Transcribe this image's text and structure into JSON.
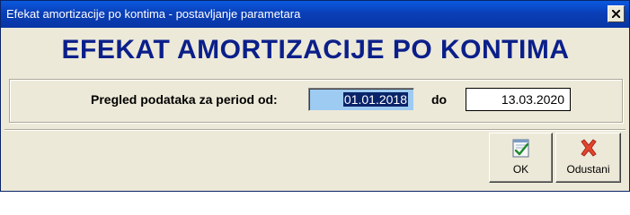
{
  "window": {
    "title": "Efekat amortizacije po kontima - postavljanje parametara"
  },
  "banner": {
    "text": "EFEKAT AMORTIZACIJE PO KONTIMA"
  },
  "period": {
    "label_from": "Pregled podataka za period od:",
    "date_from": "01.01.2018",
    "label_to": "do",
    "date_to": "13.03.2020"
  },
  "buttons": {
    "ok": "OK",
    "cancel": "Odustani"
  },
  "icons": {
    "ok": "check-document-icon",
    "cancel": "red-x-icon",
    "close": "close-icon"
  },
  "colors": {
    "title_bar": "#0a3fb8",
    "banner_text": "#0b1f8a",
    "selection": "#0a246a",
    "cancel_icon": "#e2462c"
  }
}
